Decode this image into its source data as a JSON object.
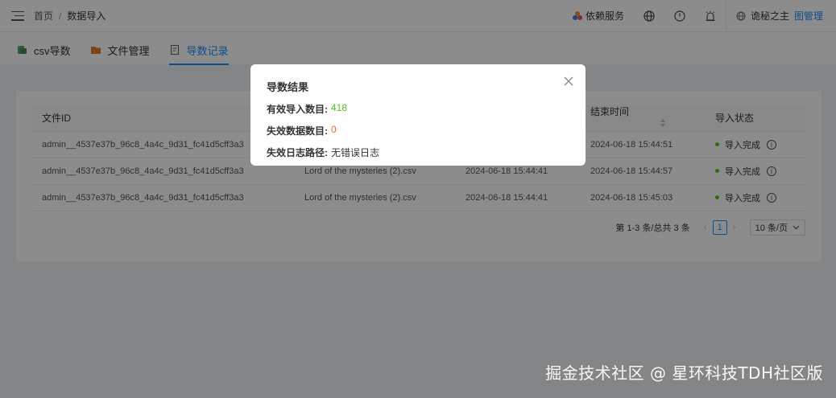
{
  "header": {
    "breadcrumb": [
      "首页",
      "数据导入"
    ],
    "dependency_service": "依赖服务",
    "user_name": "诡秘之主",
    "user_role": "图管理"
  },
  "tabs": [
    {
      "label": "csv导数",
      "icon": "csv-icon",
      "active": false
    },
    {
      "label": "文件管理",
      "icon": "folder-icon",
      "active": false
    },
    {
      "label": "导数记录",
      "icon": "record-icon",
      "active": true
    }
  ],
  "table": {
    "columns": [
      "文件ID",
      "",
      "",
      "结束时间",
      "导入状态"
    ],
    "rows": [
      {
        "file_id": "admin__4537e37b_96c8_4a4c_9d31_fc41d5cff3a3",
        "file_name": "",
        "start_time": "",
        "end_time": "2024-06-18 15:44:51",
        "status": "导入完成"
      },
      {
        "file_id": "admin__4537e37b_96c8_4a4c_9d31_fc41d5cff3a3",
        "file_name": "Lord of the mysteries (2).csv",
        "start_time": "2024-06-18 15:44:41",
        "end_time": "2024-06-18 15:44:57",
        "status": "导入完成"
      },
      {
        "file_id": "admin__4537e37b_96c8_4a4c_9d31_fc41d5cff3a3",
        "file_name": "Lord of the mysteries (2).csv",
        "start_time": "2024-06-18 15:44:41",
        "end_time": "2024-06-18 15:45:03",
        "status": "导入完成"
      }
    ]
  },
  "pagination": {
    "total_text": "第 1-3 条/总共 3 条",
    "current_page": "1",
    "page_size": "10 条/页"
  },
  "modal": {
    "title": "导数结果",
    "valid_label": "有效导入数目:",
    "valid_value": "418",
    "invalid_label": "失效数据数目:",
    "invalid_value": "0",
    "log_label": "失效日志路径:",
    "log_value": "无错误日志"
  },
  "watermark": "掘金技术社区 @ 星环科技TDH社区版",
  "colors": {
    "accent": "#1890ff",
    "success": "#52c41a",
    "warning": "#fa6a1e"
  }
}
